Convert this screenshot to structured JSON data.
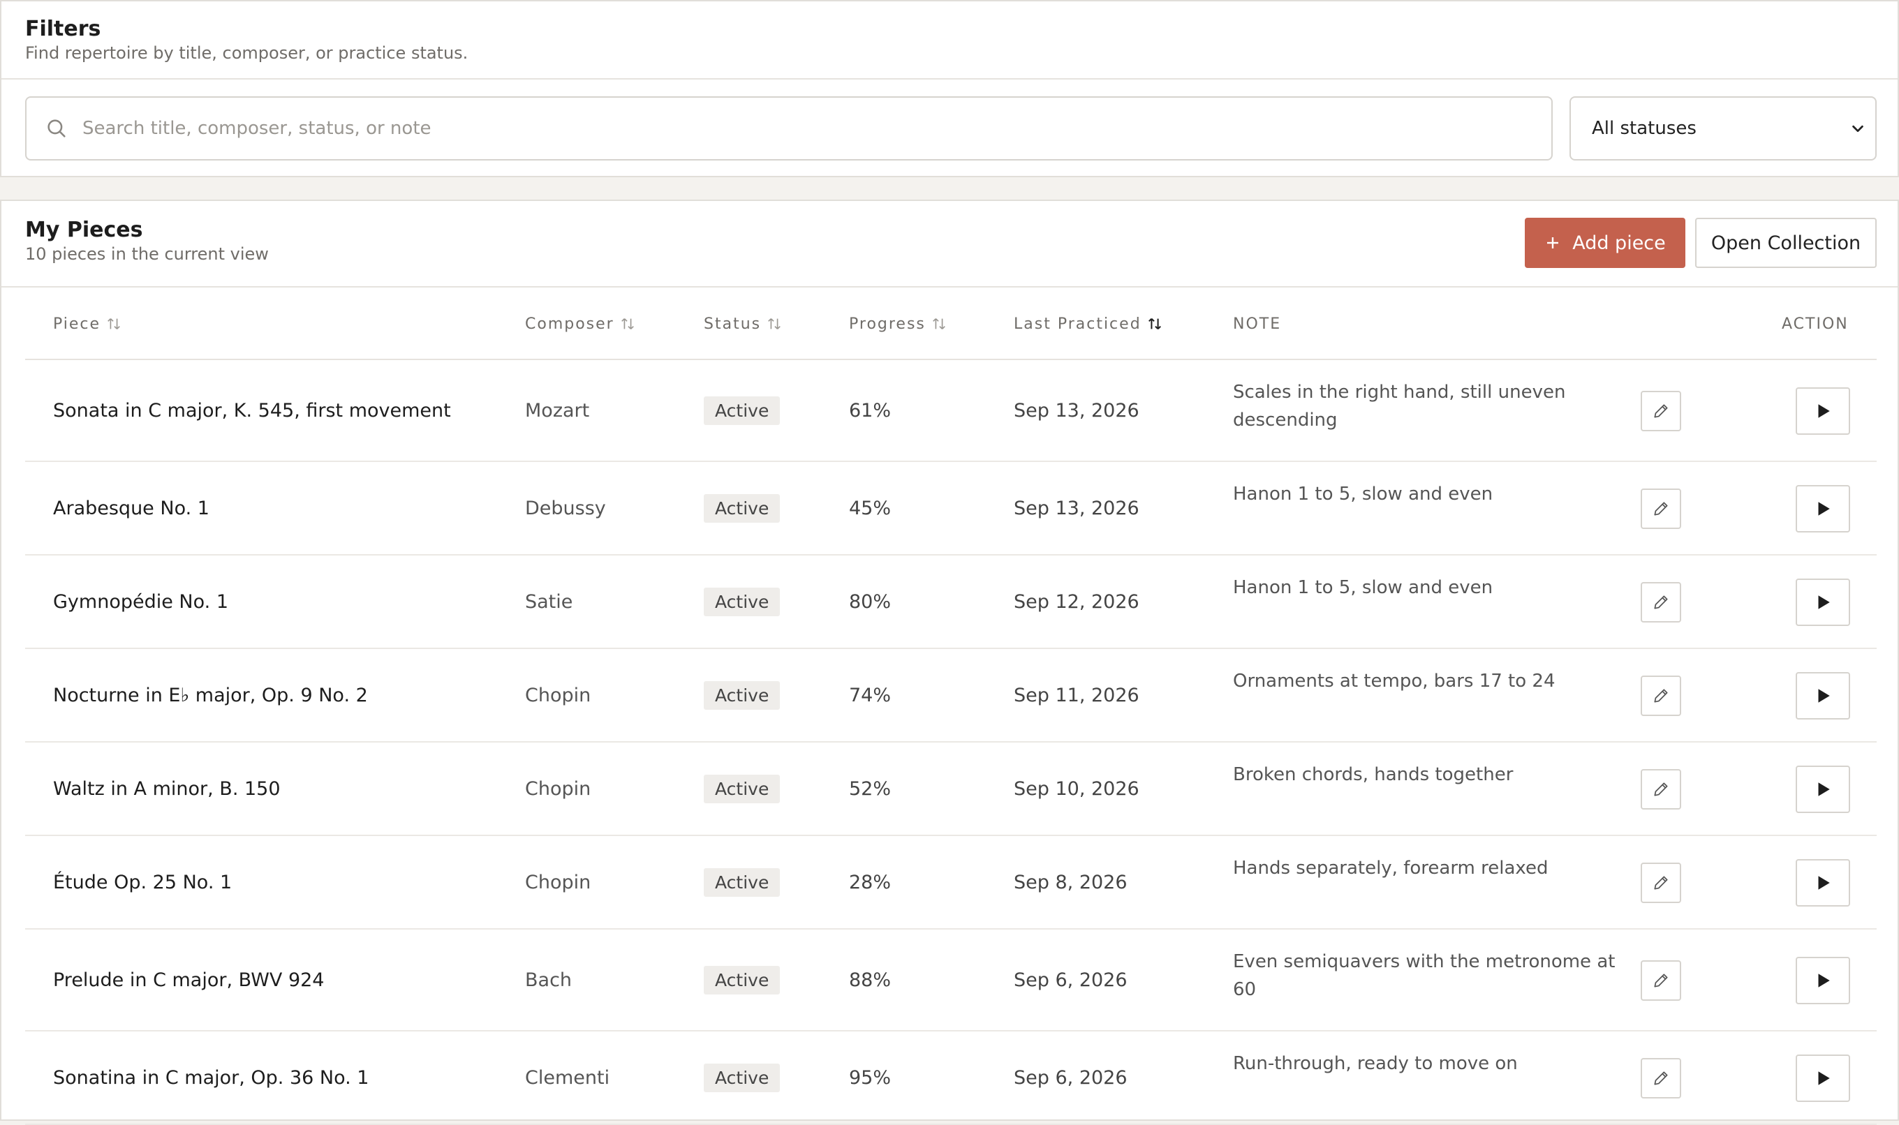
{
  "filters": {
    "title": "Filters",
    "subtitle": "Find repertoire by title, composer, or practice status.",
    "search_placeholder": "Search title, composer, status, or note",
    "status_selected": "All statuses"
  },
  "pieces": {
    "title": "My Pieces",
    "subtitle": "10 pieces in the current view",
    "add_label": "Add piece",
    "open_label": "Open Collection",
    "columns": {
      "piece": "Piece",
      "composer": "Composer",
      "status": "Status",
      "progress": "Progress",
      "last": "Last Practiced",
      "note": "NOTE",
      "action": "ACTION"
    },
    "rows": [
      {
        "piece": "Sonata in C major, K. 545, first movement",
        "composer": "Mozart",
        "status": "Active",
        "progress": "61%",
        "last": "Sep 13, 2026",
        "note": "Scales in the right hand, still uneven descending"
      },
      {
        "piece": "Arabesque No. 1",
        "composer": "Debussy",
        "status": "Active",
        "progress": "45%",
        "last": "Sep 13, 2026",
        "note": "Hanon 1 to 5, slow and even"
      },
      {
        "piece": "Gymnopédie No. 1",
        "composer": "Satie",
        "status": "Active",
        "progress": "80%",
        "last": "Sep 12, 2026",
        "note": "Hanon 1 to 5, slow and even"
      },
      {
        "piece": "Nocturne in E♭ major, Op. 9 No. 2",
        "composer": "Chopin",
        "status": "Active",
        "progress": "74%",
        "last": "Sep 11, 2026",
        "note": "Ornaments at tempo, bars 17 to 24"
      },
      {
        "piece": "Waltz in A minor, B. 150",
        "composer": "Chopin",
        "status": "Active",
        "progress": "52%",
        "last": "Sep 10, 2026",
        "note": "Broken chords, hands together"
      },
      {
        "piece": "Étude Op. 25 No. 1",
        "composer": "Chopin",
        "status": "Active",
        "progress": "28%",
        "last": "Sep 8, 2026",
        "note": "Hands separately, forearm relaxed"
      },
      {
        "piece": "Prelude in C major, BWV 924",
        "composer": "Bach",
        "status": "Active",
        "progress": "88%",
        "last": "Sep 6, 2026",
        "note": "Even semiquavers with the metronome at 60"
      },
      {
        "piece": "Sonatina in C major, Op. 36 No. 1",
        "composer": "Clementi",
        "status": "Active",
        "progress": "95%",
        "last": "Sep 6, 2026",
        "note": "Run-through, ready to move on"
      }
    ]
  },
  "colors": {
    "accent": "#c4614d"
  }
}
